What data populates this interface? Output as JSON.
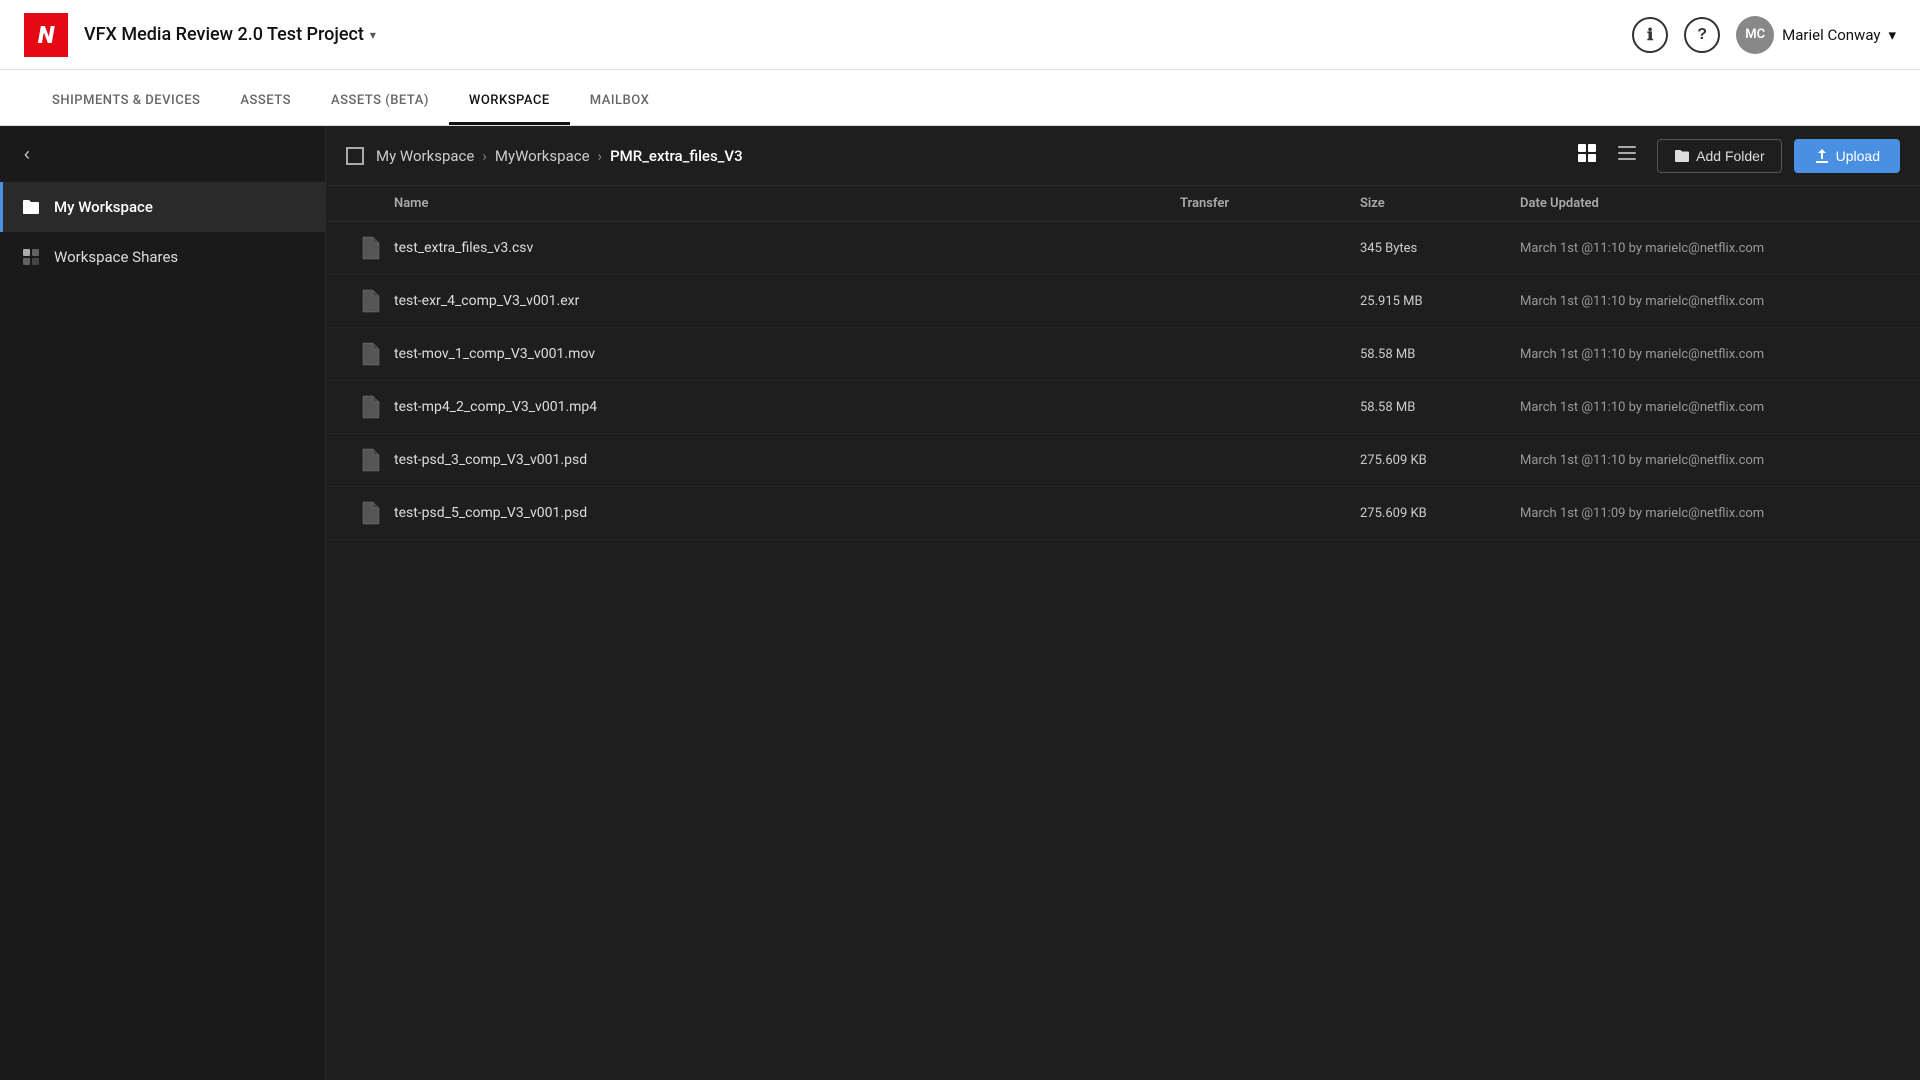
{
  "header": {
    "logo": "N",
    "project_title": "VFX Media Review 2.0 Test Project",
    "dropdown_arrow": "▾",
    "info_icon": "ℹ",
    "help_icon": "?",
    "user_initials": "MC",
    "user_name": "Mariel Conway",
    "user_dropdown_arrow": "▾"
  },
  "nav": {
    "tabs": [
      {
        "id": "shipments",
        "label": "SHIPMENTS & DEVICES",
        "active": false
      },
      {
        "id": "assets",
        "label": "ASSETS",
        "active": false
      },
      {
        "id": "assets-beta",
        "label": "ASSETS (BETA)",
        "active": false
      },
      {
        "id": "workspace",
        "label": "WORKSPACE",
        "active": true
      },
      {
        "id": "mailbox",
        "label": "MAILBOX",
        "active": false
      }
    ]
  },
  "sidebar": {
    "collapse_arrow": "‹",
    "items": [
      {
        "id": "my-workspace",
        "label": "My Workspace",
        "icon": "📁",
        "active": true
      },
      {
        "id": "workspace-shares",
        "label": "Workspace Shares",
        "icon": "📋",
        "active": false
      }
    ]
  },
  "toolbar": {
    "breadcrumb": {
      "parts": [
        {
          "label": "My Workspace"
        },
        {
          "sep": ">"
        },
        {
          "label": "MyWorkspace"
        },
        {
          "sep": ">"
        },
        {
          "label": "PMR_extra_files_V3"
        }
      ]
    },
    "add_folder_label": "Add Folder",
    "upload_label": "Upload"
  },
  "file_list": {
    "columns": {
      "name": "Name",
      "transfer": "Transfer",
      "size": "Size",
      "date_updated": "Date Updated"
    },
    "files": [
      {
        "name": "test_extra_files_v3.csv",
        "transfer": "",
        "size": "345 Bytes",
        "date_updated": "March 1st @11:10 by marielc@netflix.com"
      },
      {
        "name": "test-exr_4_comp_V3_v001.exr",
        "transfer": "",
        "size": "25.915 MB",
        "date_updated": "March 1st @11:10 by marielc@netflix.com"
      },
      {
        "name": "test-mov_1_comp_V3_v001.mov",
        "transfer": "",
        "size": "58.58 MB",
        "date_updated": "March 1st @11:10 by marielc@netflix.com"
      },
      {
        "name": "test-mp4_2_comp_V3_v001.mp4",
        "transfer": "",
        "size": "58.58 MB",
        "date_updated": "March 1st @11:10 by marielc@netflix.com"
      },
      {
        "name": "test-psd_3_comp_V3_v001.psd",
        "transfer": "",
        "size": "275.609 KB",
        "date_updated": "March 1st @11:10 by marielc@netflix.com"
      },
      {
        "name": "test-psd_5_comp_V3_v001.psd",
        "transfer": "",
        "size": "275.609 KB",
        "date_updated": "March 1st @11:09 by marielc@netflix.com"
      }
    ]
  }
}
